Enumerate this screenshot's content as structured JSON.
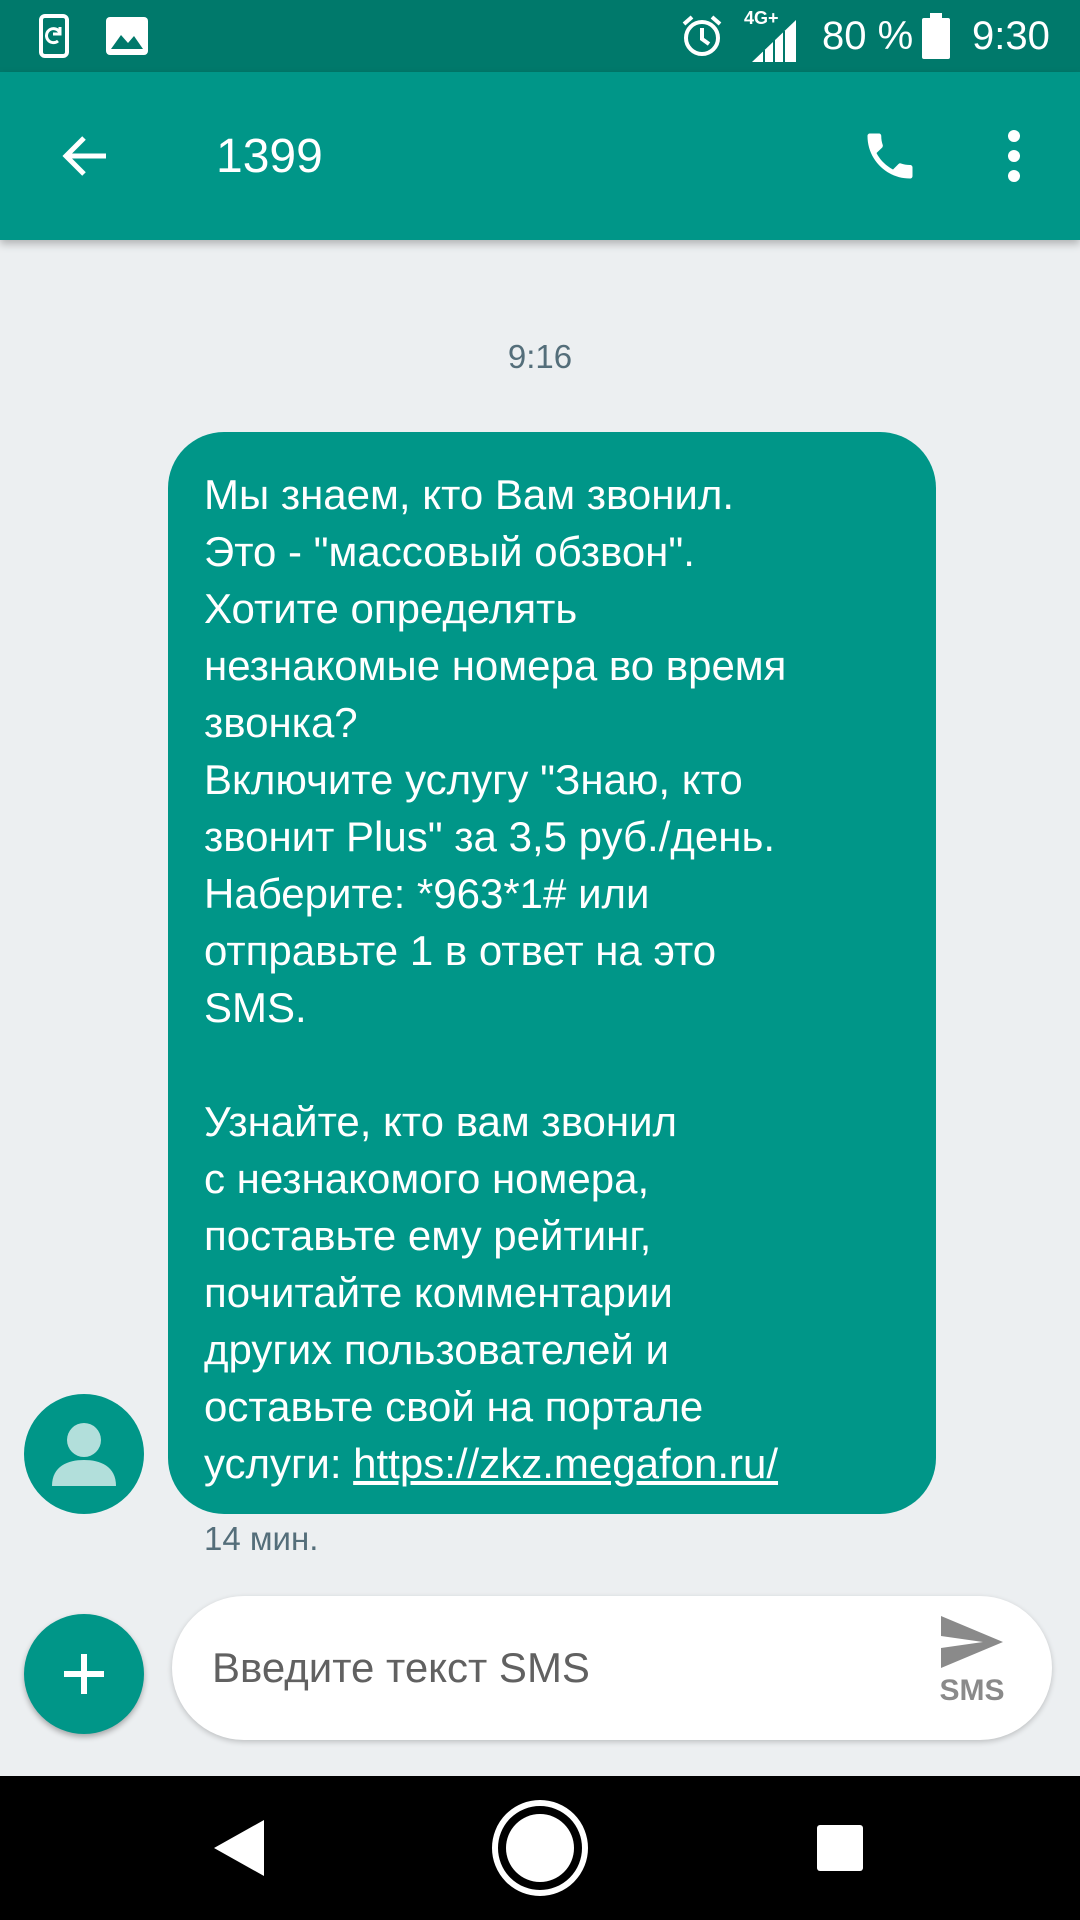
{
  "status_bar": {
    "battery_percent": "80 %",
    "network": "4G+",
    "time": "9:30"
  },
  "app_bar": {
    "title": "1399"
  },
  "conversation": {
    "date_stamp": "9:16",
    "message": {
      "lines": [
        "Мы знаем, кто Вам звонил.",
        "Это - \"массовый обзвон\".",
        "Хотите определять",
        "незнакомые номера во время",
        "звонка?",
        "Включите услугу \"Знаю, кто",
        "звонит Plus\" за 3,5 руб./день.",
        "Наберите: *963*1# или",
        "отправьте 1 в ответ на это",
        "SMS.",
        "",
        "Узнайте, кто вам звонил",
        "с незнакомого номера,",
        "поставьте ему рейтинг,",
        "почитайте комментарии",
        "других пользователей и",
        "оставьте свой на портале"
      ],
      "last_line_prefix": "услуги: ",
      "link": "https://zkz.megafon.ru/",
      "time": "14 мин."
    }
  },
  "compose": {
    "placeholder": "Введите текст SMS",
    "send_label": "SMS"
  },
  "colors": {
    "primary": "#009688",
    "primary_dark": "#00796b",
    "background": "#eceff1"
  }
}
